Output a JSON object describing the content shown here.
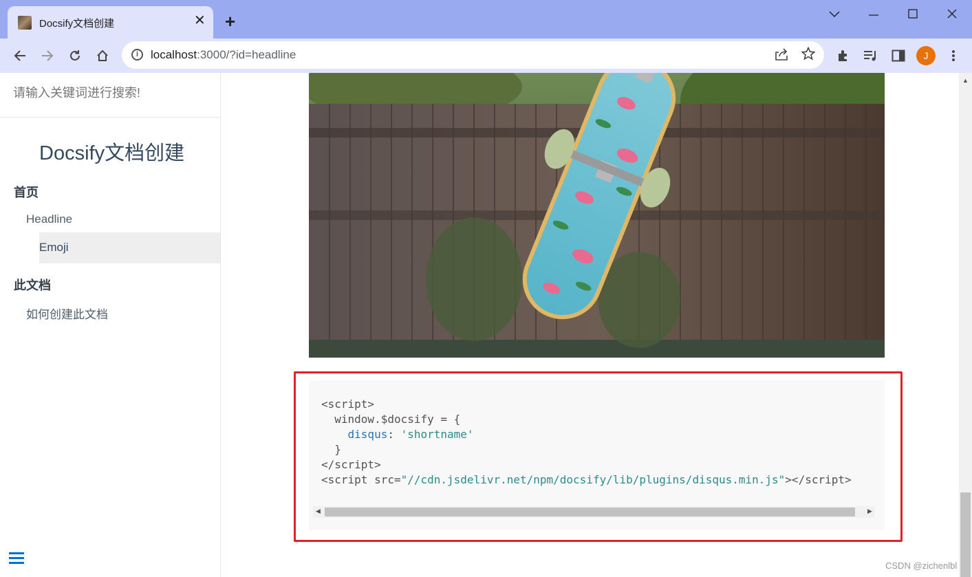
{
  "browser": {
    "tab_title": "Docsify文档创建",
    "url_host": "localhost",
    "url_rest": ":3000/?id=headline",
    "profile_initial": "J"
  },
  "sidebar": {
    "search_placeholder": "请输入关键词进行搜索!",
    "site_name": "Docsify文档创建",
    "groups": [
      {
        "title": "首页",
        "items": [
          "Headline",
          "Emoji"
        ]
      },
      {
        "title": "此文档",
        "items": [
          "如何创建此文档"
        ]
      }
    ],
    "active_item": "Emoji"
  },
  "code": {
    "lines": [
      "<script>",
      "  window.$docsify = {",
      "    disqus: 'shortname'",
      "  }",
      "</script>",
      "<script src=\"//cdn.jsdelivr.net/npm/docsify/lib/plugins/disqus.min.js\"></script>"
    ],
    "line3_key": "disqus",
    "line3_colon": ": ",
    "line3_value": "'shortname'",
    "line6_prefix": "<script src=",
    "line6_value": "\"//cdn.jsdelivr.net/npm/docsify/lib/plugins/disqus.min.js\"",
    "line6_suffix": "></script>"
  },
  "watermark": "CSDN @zichenlbl",
  "colors": {
    "highlight_border": "#e0212b",
    "tabbar_bg": "#9aaaf0",
    "toolbar_bg": "#dfe3fb",
    "link_color": "#2973b7",
    "string_color": "#2c8b8a",
    "profile_bg": "#e8710a"
  }
}
